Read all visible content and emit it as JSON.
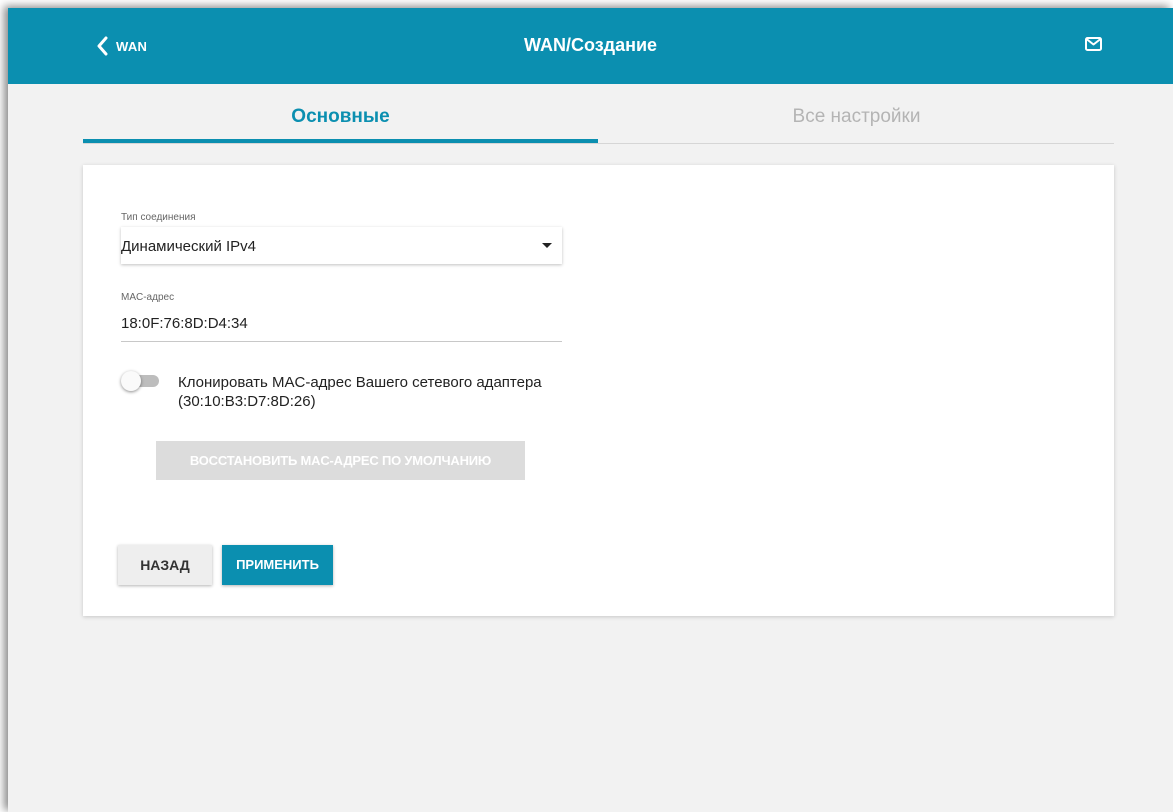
{
  "header": {
    "back_label": "WAN",
    "title": "WAN/Создание",
    "back_icon": "chevron-left-icon",
    "mail_icon": "mail-icon",
    "color": "#0b8fb0"
  },
  "tabs": [
    {
      "label": "Основные",
      "active": true
    },
    {
      "label": "Все настройки",
      "active": false
    }
  ],
  "form": {
    "connection_type_label": "Тип соединения",
    "connection_type_value": "Динамический IPv4",
    "mac_label": "MAC-адрес",
    "mac_value": "18:0F:76:8D:D4:34",
    "clone_toggle_label": "Клонировать MAC-адрес Вашего сетевого адаптера (30:10:B3:D7:8D:26)",
    "clone_toggle_on": false,
    "restore_button": "ВОССТАНОВИТЬ MAC-АДРЕС ПО УМОЛЧАНИЮ"
  },
  "actions": {
    "back": "НАЗАД",
    "apply": "ПРИМЕНИТЬ"
  }
}
